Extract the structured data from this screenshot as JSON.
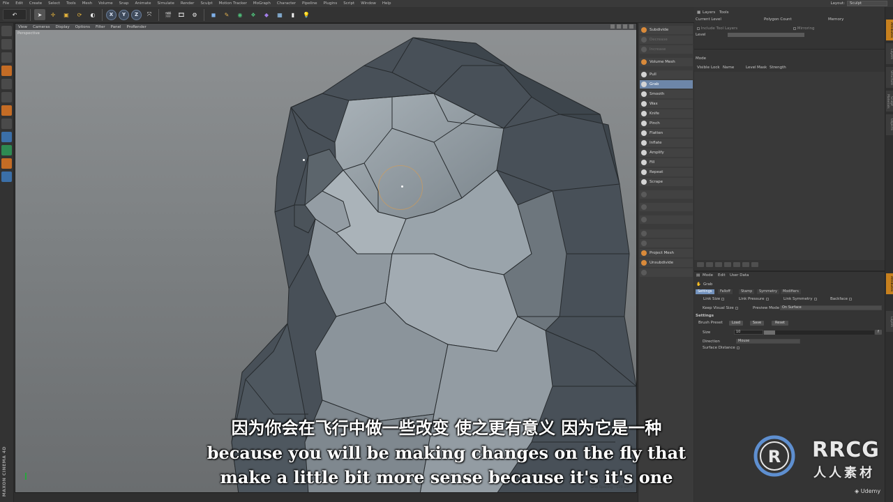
{
  "menu": [
    "File",
    "Edit",
    "Create",
    "Select",
    "Tools",
    "Mesh",
    "Volume",
    "Snap",
    "Animate",
    "Simulate",
    "Render",
    "Sculpt",
    "Motion Tracker",
    "MoGraph",
    "Character",
    "Pipeline",
    "Plugins",
    "Script",
    "Window",
    "Help"
  ],
  "layout": {
    "label": "Layout:",
    "value": "Sculpt"
  },
  "toolbar": {
    "axes": [
      "X",
      "Y",
      "Z"
    ]
  },
  "viewport": {
    "menu": [
      "View",
      "Cameras",
      "Display",
      "Options",
      "Filter",
      "Panel",
      "ProRender"
    ],
    "camera_label": "Perspective",
    "grid_spacing": "Grid Spacing : 100 cm"
  },
  "brushes": {
    "top": [
      "Subdivide",
      "Decrease",
      "Increase"
    ],
    "volume": "Volume Mesh",
    "items": [
      "Pull",
      "Grab",
      "Smooth",
      "Wax",
      "Knife",
      "Pinch",
      "Flatten",
      "Inflate",
      "Amplify",
      "Fill",
      "Repeat",
      "Scrape"
    ],
    "active_index": 1,
    "bottom": [
      "Project Mesh",
      "Unsubdivide"
    ]
  },
  "layers_panel": {
    "tabs": [
      "Layers",
      "Tools"
    ],
    "headers": [
      "Current Level",
      "Polygon Count",
      "Memory"
    ],
    "options": [
      "Include Tool Layers",
      "Mirroring"
    ],
    "level_label": "Level",
    "mode_label": "Mode",
    "columns": [
      "Visible",
      "Lock",
      "Name",
      "Level",
      "Mask",
      "Strength"
    ]
  },
  "attributes": {
    "menu": [
      "Mode",
      "Edit",
      "User Data"
    ],
    "tool_name": "Grab",
    "tabs": [
      "Settings",
      "Falloff",
      "Stamp",
      "Symmetry",
      "Modifiers"
    ],
    "active_tab": 0,
    "row1": [
      "Link Size",
      "Link Pressure",
      "Link Symmetry",
      "Backface"
    ],
    "keep_visual_size": "Keep Visual Size",
    "preview_mode_label": "Preview Mode",
    "preview_mode_value": "On Surface",
    "settings_header": "Settings",
    "brush_preset_label": "Brush Preset",
    "preset_buttons": [
      "Load",
      "Save",
      "Reset"
    ],
    "size_label": "Size",
    "size_value": "10",
    "direction_label": "Direction",
    "direction_value": "Mouse",
    "surface_distance": "Surface Distance"
  },
  "side_tabs": [
    "Attributes",
    "Layers",
    "Structure",
    "Sculpt Materials",
    "Objects"
  ],
  "subtitles": {
    "cn": "因为你会在飞行中做一些改变 使之更有意义 因为它是一种",
    "en1": "because you will be making changes on the fly that",
    "en2": "make a little bit more sense because it's it's one"
  },
  "watermark": {
    "brand": "RRCG",
    "brand_cn": "人人素材",
    "platform": "Udemy",
    "maxon": "MAXON CINEMA 4D"
  }
}
